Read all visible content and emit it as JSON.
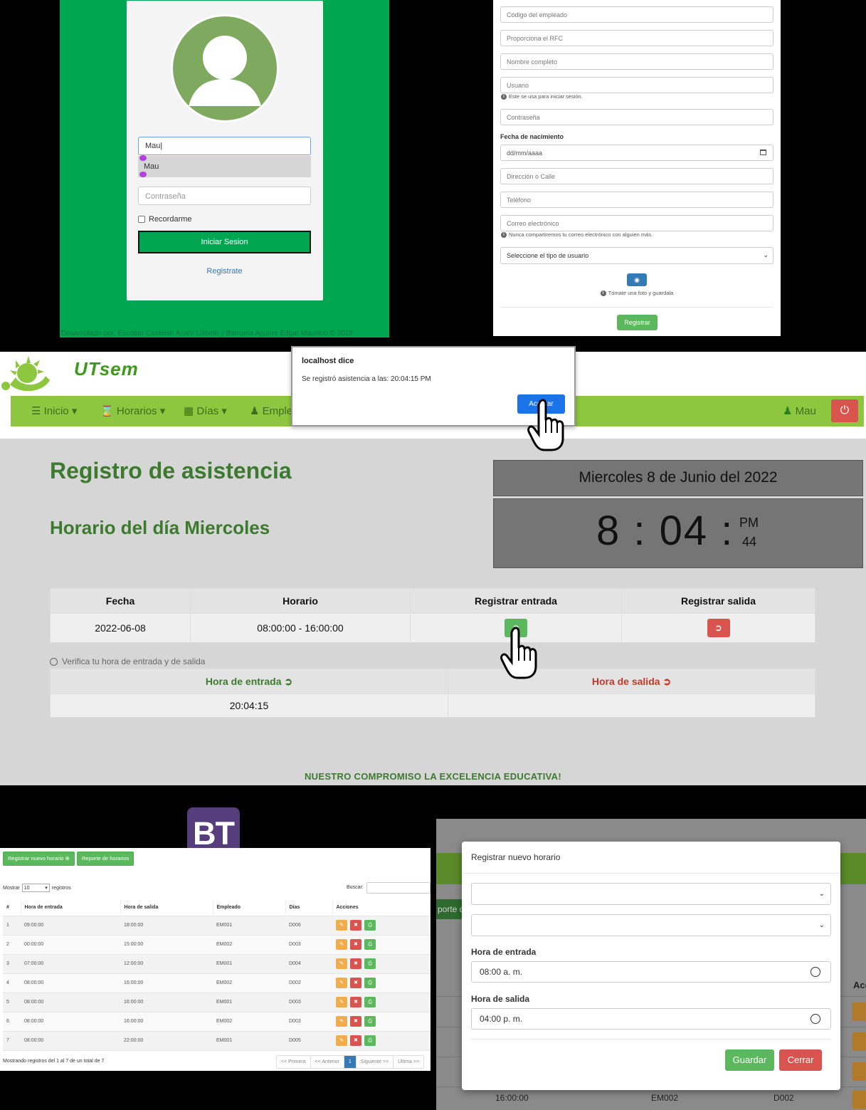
{
  "login": {
    "username_value": "Mau",
    "autofill_suggestion": "Mau",
    "password_placeholder": "Contraseña",
    "remember_label": "Recordarme",
    "submit_label": "Iniciar Sesion",
    "register_link": "Registrate",
    "footer": "Desarrollado por: Escobar Castelán Anahí Lilibeth y Barrueta Aguirre Edgar Mauricio © 2018"
  },
  "register": {
    "employee_code": "Código del empleado",
    "rfc": "Proporciona el RFC",
    "full_name": "Nombre completo",
    "username": "Usuario",
    "username_help": "Este se usa para iniciar sesión.",
    "password": "Contraseña",
    "dob_label": "Fecha de nacimiento",
    "dob_placeholder": "dd/mm/aaaa",
    "address": "Dirección o Calle",
    "phone": "Teléfono",
    "email": "Correo electrónico",
    "email_help": "Nunca compartiremos tu correo electrónico con alguien más.",
    "user_type": "Seleccione el tipo de usuario",
    "photo_help": "Tómate una foto y guardala",
    "submit": "Registrar"
  },
  "attendance": {
    "brand": "UTsem",
    "nav": {
      "inicio": "Inicio",
      "horarios": "Horarios",
      "dias": "Días",
      "empleados": "Emple",
      "user": "Mau"
    },
    "title": "Registro de asistencia",
    "subtitle": "Horario del día Miercoles",
    "date_display": "Miercoles 8 de Junio del 2022",
    "clock": {
      "time": "8 : 04 :",
      "ampm": "PM",
      "seconds": "44"
    },
    "table": {
      "headers": [
        "Fecha",
        "Horario",
        "Registrar entrada",
        "Registrar salida"
      ],
      "row": {
        "fecha": "2022-06-08",
        "horario": "08:00:00 - 16:00:00"
      }
    },
    "verify_note": "Verifica tu hora de entrada y de salida",
    "hours": {
      "entry_header": "Hora de entrada",
      "exit_header": "Hora de salida",
      "entry_value": "20:04:15",
      "exit_value": ""
    },
    "motto": "NUESTRO COMPROMISO LA EXCELENCIA EDUCATIVA!",
    "colors": {
      "nav_green": "#8dc63f",
      "title_green": "#3c7a2e",
      "exit_red": "#c0392b"
    }
  },
  "alert": {
    "title": "localhost dice",
    "message": "Se registró asistencia a las: 20:04:15 PM",
    "ok": "Aceptar"
  },
  "bt_logo": "BT",
  "schedules": {
    "new_btn": "Registrar nuevo horario",
    "report_btn": "Reporte de horarios",
    "show_label": "Mostrar",
    "show_value": "10",
    "records_label": "registros",
    "search_label": "Buscar:",
    "headers": [
      "#",
      "Hora de entrada",
      "Hora de salida",
      "Empleado",
      "Dias",
      "Acciones"
    ],
    "rows": [
      [
        "1",
        "09:00:00",
        "18:00:00",
        "EM001",
        "D006"
      ],
      [
        "2",
        "00:00:00",
        "15:00:00",
        "EM002",
        "D003"
      ],
      [
        "3",
        "07:00:00",
        "12:00:00",
        "EM001",
        "D004"
      ],
      [
        "4",
        "08:00:00",
        "16:00:00",
        "EM002",
        "D002"
      ],
      [
        "5",
        "08:00:00",
        "16:00:00",
        "EM001",
        "D003"
      ],
      [
        "6",
        "08:00:00",
        "16:00:00",
        "EM002",
        "D003"
      ],
      [
        "7",
        "08:00:00",
        "22:00:00",
        "EM001",
        "D005"
      ]
    ],
    "info": "Mostrando registros del 1 al 7 de un total de 7",
    "pager": {
      "first": "<< Primera",
      "prev": "<< Anterior",
      "page": "1",
      "next": "Siguiente >>",
      "last": "Última >>"
    }
  },
  "modal": {
    "title": "Registrar nuevo horario",
    "entry_label": "Hora de entrada",
    "entry_value": "08:00 a. m.",
    "exit_label": "Hora de salida",
    "exit_value": "04:00 p. m.",
    "save": "Guardar",
    "close": "Cerrar",
    "bg_report_fragment": "porte d",
    "bg_actions_fragment": "Acc",
    "bg_row": {
      "time": "16:00:00",
      "emp": "EM002",
      "day": "D002"
    }
  }
}
